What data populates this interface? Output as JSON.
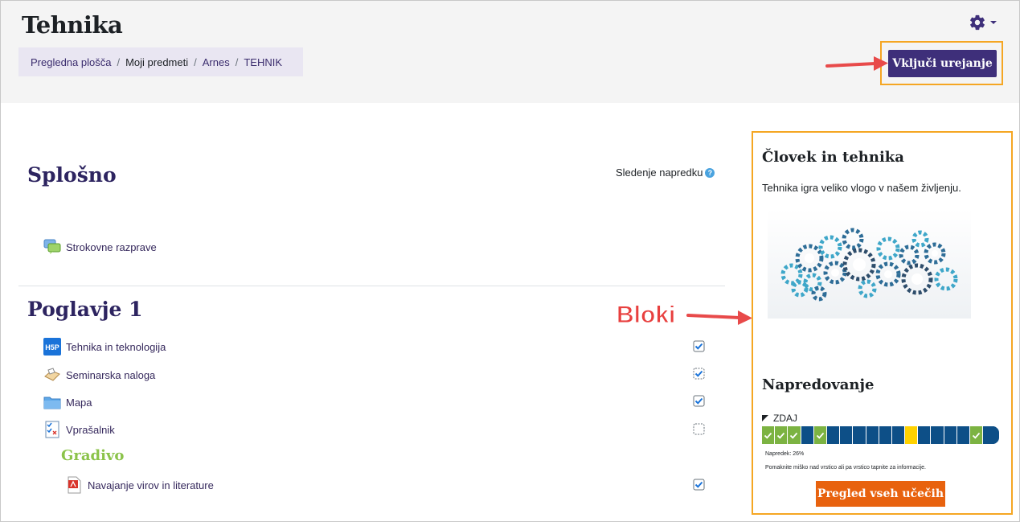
{
  "header": {
    "title": "Tehnika",
    "breadcrumb": [
      "Pregledna plošča",
      "Moji predmeti",
      "Arnes",
      "TEHNIK"
    ],
    "edit_button": "Vključi urejanje",
    "settings_icon": "gear-icon"
  },
  "sections": {
    "general": {
      "title": "Splošno",
      "progress_tracking": "Sledenje napredku",
      "help_glyph": "?",
      "activities": [
        {
          "label": "Strokovne razprave",
          "icon": "forum-icon"
        }
      ]
    },
    "chapter1": {
      "title": "Poglavje 1",
      "activities": [
        {
          "label": "Tehnika in teknologija",
          "icon": "h5p-icon",
          "completion": "manual-done"
        },
        {
          "label": "Seminarska naloga",
          "icon": "assignment-icon",
          "completion": "auto-done"
        },
        {
          "label": "Mapa",
          "icon": "folder-icon",
          "completion": "manual-done"
        },
        {
          "label": "Vprašalnik",
          "icon": "quiz-icon",
          "completion": "auto-pending"
        }
      ],
      "subheading": "Gradivo",
      "materials": [
        {
          "label": "Navajanje virov in literature",
          "icon": "pdf-icon",
          "completion": "manual-done"
        }
      ]
    }
  },
  "annotation": {
    "label": "Bloki",
    "color": "#e8403f",
    "highlight_color": "#f5a623"
  },
  "blocks": {
    "about": {
      "title": "Človek in tehnika",
      "text": "Tehnika igra veliko vlogo v našem življenju."
    },
    "progress": {
      "title": "Napredovanje",
      "now_label": "ZDAJ",
      "cells": [
        "done",
        "done",
        "done",
        "todo",
        "done",
        "todo",
        "todo",
        "todo",
        "todo",
        "todo",
        "todo",
        "now",
        "todo",
        "todo",
        "todo",
        "todo",
        "done",
        "todo"
      ],
      "percent_text": "Napredek: 26%",
      "hint": "Pomaknite miško nad vrstico ali pa vrstico tapnite za informacije.",
      "overview_button": "Pregled vseh učečih"
    }
  },
  "colors": {
    "brand": "#3e2f7a",
    "accent": "#e8620e",
    "done": "#7cb342",
    "todo": "#0d4f87",
    "now": "#ffd200"
  }
}
